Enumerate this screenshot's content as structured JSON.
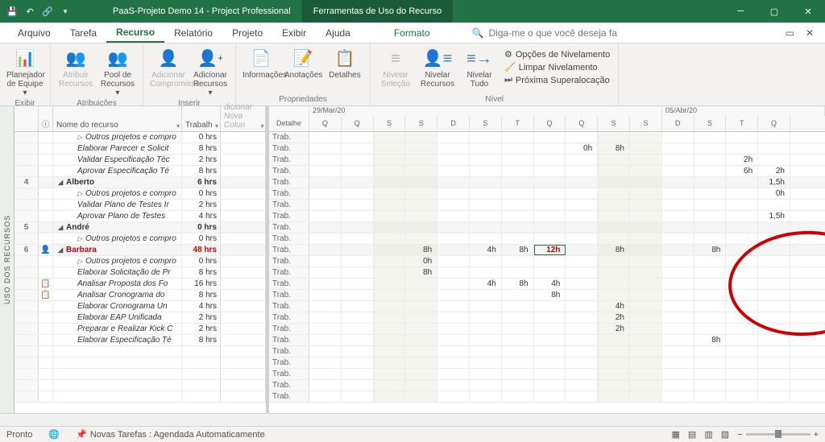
{
  "title": {
    "doc": "PaaS-Projeto Demo 14",
    "app": "Project Professional",
    "context": "Ferramentas de Uso do Recurso"
  },
  "tabs": {
    "arquivo": "Arquivo",
    "tarefa": "Tarefa",
    "recurso": "Recurso",
    "relatorio": "Relatório",
    "projeto": "Projeto",
    "exibir": "Exibir",
    "ajuda": "Ajuda",
    "formato": "Formato"
  },
  "tellme_placeholder": "Diga-me o que você deseja fa",
  "ribbon": {
    "exibir": {
      "label": "Exibir",
      "planejador": "Planejador de Equipe ▾"
    },
    "atrib": {
      "label": "Atribuições",
      "atribuir": "Atribuir Recursos",
      "pool": "Pool de Recursos ▾"
    },
    "inserir": {
      "label": "Inserir",
      "adic_comp": "Adicionar Compromisso",
      "adic_rec": "Adicionar Recursos ▾"
    },
    "prop": {
      "label": "Propriedades",
      "info": "Informações",
      "anot": "Anotações",
      "det": "Detalhes"
    },
    "nivel": {
      "label": "Nível",
      "sel": "Nivelar Seleção",
      "rec": "Nivelar Recursos",
      "tudo": "Nivelar Tudo",
      "opt": "Opções de Nivelamento",
      "limp": "Limpar Nivelamento",
      "prox": "Próxima Superalocação"
    }
  },
  "sidetab": "USO DOS RECURSOS",
  "cols": {
    "info": "ⓘ",
    "nome": "Nome do recurso",
    "trab": "Trabalh",
    "add": "dicionar Nova Colun",
    "det": "Detalhe"
  },
  "weeks": {
    "w1": "29/Mar/20",
    "w2": "05/Abr/20"
  },
  "days": [
    "Q",
    "Q",
    "S",
    "S",
    "D",
    "S",
    "T",
    "Q",
    "Q",
    "S",
    "S",
    "D",
    "S",
    "T",
    "Q"
  ],
  "detail_label": "Trab.",
  "rows": [
    {
      "idx": "",
      "sum": false,
      "name": "Outros projetos e compro",
      "work": "0 hrs",
      "indent": 2,
      "exp": "▷",
      "cells": {}
    },
    {
      "idx": "",
      "sum": false,
      "name": "Elaborar Parecer e Solicit",
      "work": "8 hrs",
      "indent": 2,
      "cells": {
        "8": "0h",
        "9": "8h"
      }
    },
    {
      "idx": "",
      "sum": false,
      "name": "Validar Especificação Téc",
      "work": "2 hrs",
      "indent": 2,
      "cells": {
        "13": "2h"
      }
    },
    {
      "idx": "",
      "sum": false,
      "name": "Aprovar Especificação Té",
      "work": "8 hrs",
      "indent": 2,
      "cells": {
        "13": "6h",
        "14": "2h"
      }
    },
    {
      "idx": "4",
      "sum": true,
      "name": "Alberto",
      "work": "6 hrs",
      "indent": 0,
      "exp": "◢",
      "cells": {
        "14": "1,5h"
      }
    },
    {
      "idx": "",
      "sum": false,
      "name": "Outros projetos e compro",
      "work": "0 hrs",
      "indent": 2,
      "exp": "▷",
      "cells": {
        "14": "0h"
      }
    },
    {
      "idx": "",
      "sum": false,
      "name": "Validar Plano de Testes Ir",
      "work": "2 hrs",
      "indent": 2,
      "cells": {}
    },
    {
      "idx": "",
      "sum": false,
      "name": "Aprovar Plano de Testes",
      "work": "4 hrs",
      "indent": 2,
      "cells": {
        "14": "1,5h"
      }
    },
    {
      "idx": "5",
      "sum": true,
      "name": "André",
      "work": "0 hrs",
      "indent": 0,
      "exp": "◢",
      "cells": {}
    },
    {
      "idx": "",
      "sum": false,
      "name": "Outros projetos e compro",
      "work": "0 hrs",
      "indent": 2,
      "exp": "▷",
      "cells": {}
    },
    {
      "idx": "6",
      "sum": true,
      "name": "Barbara",
      "work": "48 hrs",
      "indent": 0,
      "exp": "◢",
      "over": true,
      "ind": "👤",
      "cells": {
        "3": "8h",
        "5": "4h",
        "6": "8h",
        "7": "12h",
        "9": "8h",
        "12": "8h"
      }
    },
    {
      "idx": "",
      "sum": false,
      "name": "Outros projetos e compro",
      "work": "0 hrs",
      "indent": 2,
      "exp": "▷",
      "cells": {
        "3": "0h"
      }
    },
    {
      "idx": "",
      "sum": false,
      "name": "Elaborar Solicitação de Pr",
      "work": "8 hrs",
      "indent": 2,
      "cells": {
        "3": "8h"
      }
    },
    {
      "idx": "",
      "sum": false,
      "name": "Analisar Proposta dos Fo",
      "work": "16 hrs",
      "indent": 2,
      "ind": "📋",
      "cells": {
        "5": "4h",
        "6": "8h",
        "7": "4h"
      }
    },
    {
      "idx": "",
      "sum": false,
      "name": "Analisar Cronograma do",
      "work": "8 hrs",
      "indent": 2,
      "ind": "📋",
      "cells": {
        "7": "8h"
      }
    },
    {
      "idx": "",
      "sum": false,
      "name": "Elaborar Cronograma Un",
      "work": "4 hrs",
      "indent": 2,
      "cells": {
        "9": "4h"
      }
    },
    {
      "idx": "",
      "sum": false,
      "name": "Elaborar EAP Unificada",
      "work": "2 hrs",
      "indent": 2,
      "cells": {
        "9": "2h"
      }
    },
    {
      "idx": "",
      "sum": false,
      "name": "Preparar e Realizar Kick C",
      "work": "2 hrs",
      "indent": 2,
      "cells": {
        "9": "2h"
      }
    },
    {
      "idx": "",
      "sum": false,
      "name": "Elaborar Especificação Té",
      "work": "8 hrs",
      "indent": 2,
      "cells": {
        "12": "8h"
      }
    },
    {
      "idx": "",
      "sum": false,
      "name": "",
      "work": "",
      "indent": 0,
      "cells": {}
    },
    {
      "idx": "",
      "sum": false,
      "name": "",
      "work": "",
      "indent": 0,
      "cells": {}
    },
    {
      "idx": "",
      "sum": false,
      "name": "",
      "work": "",
      "indent": 0,
      "cells": {}
    },
    {
      "idx": "",
      "sum": false,
      "name": "",
      "work": "",
      "indent": 0,
      "cells": {}
    },
    {
      "idx": "",
      "sum": false,
      "name": "",
      "work": "",
      "indent": 0,
      "cells": {}
    }
  ],
  "highlight_cell": {
    "row": 10,
    "col": "7"
  },
  "status": {
    "pronto": "Pronto",
    "novas": "Novas Tarefas : Agendada Automaticamente"
  }
}
